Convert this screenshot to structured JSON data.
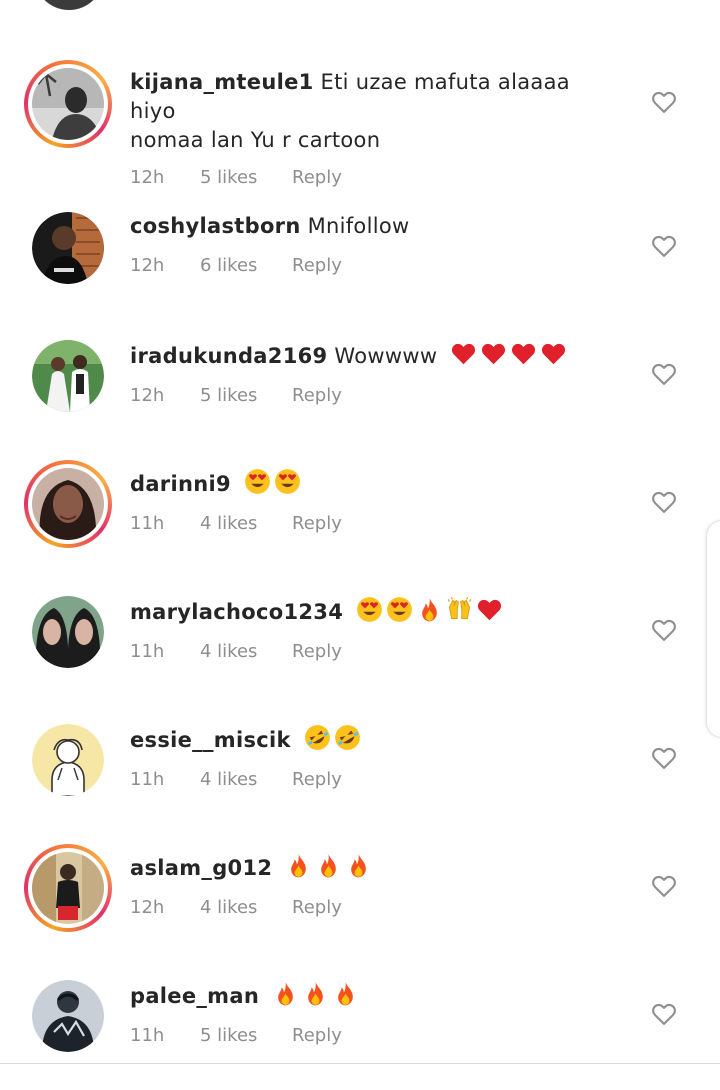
{
  "comments": [
    {
      "username": "kijana_mteule1",
      "text_line1": "Eti uzae mafuta alaaaa hiyo",
      "text_line2": "nomaa lan Yu r cartoon",
      "time": "12h",
      "likes": "5 likes",
      "reply": "Reply",
      "story_ring": true,
      "emojis": []
    },
    {
      "username": "coshylastborn",
      "text_line1": "Mnifollow",
      "time": "12h",
      "likes": "6 likes",
      "reply": "Reply",
      "story_ring": false,
      "emojis": []
    },
    {
      "username": "iradukunda2169",
      "text_line1": "Wowwww",
      "time": "12h",
      "likes": "5 likes",
      "reply": "Reply",
      "story_ring": false,
      "emojis": [
        "red-heart",
        "red-heart",
        "red-heart",
        "red-heart"
      ]
    },
    {
      "username": "darinni9",
      "text_line1": "",
      "time": "11h",
      "likes": "4 likes",
      "reply": "Reply",
      "story_ring": true,
      "emojis": [
        "heart-eyes",
        "heart-eyes"
      ]
    },
    {
      "username": "marylachoco1234",
      "text_line1": "",
      "time": "11h",
      "likes": "4 likes",
      "reply": "Reply",
      "story_ring": false,
      "emojis": [
        "heart-eyes",
        "heart-eyes",
        "fire",
        "raising-hands",
        "red-heart"
      ]
    },
    {
      "username": "essie__miscik",
      "text_line1": "",
      "time": "11h",
      "likes": "4 likes",
      "reply": "Reply",
      "story_ring": false,
      "emojis": [
        "rolling-laughing",
        "rolling-laughing"
      ]
    },
    {
      "username": "aslam_g012",
      "text_line1": "",
      "time": "12h",
      "likes": "4 likes",
      "reply": "Reply",
      "story_ring": true,
      "emojis": [
        "fire",
        "fire",
        "fire"
      ]
    },
    {
      "username": "palee_man",
      "text_line1": "",
      "time": "11h",
      "likes": "5 likes",
      "reply": "Reply",
      "story_ring": false,
      "emojis": [
        "fire",
        "fire",
        "fire"
      ]
    }
  ],
  "colors": {
    "username": "#262626",
    "meta_text": "#8e8e8e",
    "story_ring_start": "#f5a623",
    "story_ring_end": "#e1306c"
  },
  "icons": {
    "like": "heart-outline-icon"
  }
}
